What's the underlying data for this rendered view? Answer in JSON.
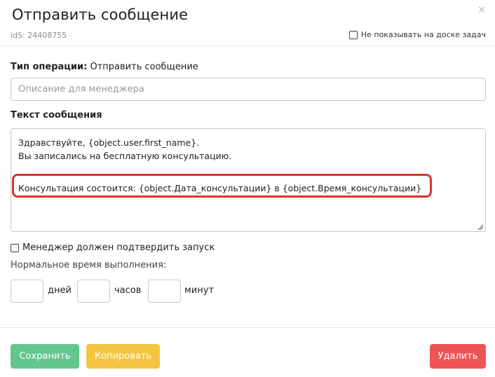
{
  "dialog": {
    "title": "Отправить сообщение",
    "close_glyph": "×",
    "ids_text": "idS: 24408755",
    "hide_on_board_label": "Не показывать на доске задач"
  },
  "operation": {
    "type_label": "Тип операции:",
    "type_value": "Отправить сообщение",
    "description_placeholder": "Описание для менеджера"
  },
  "message": {
    "label": "Текст сообщения",
    "lines": [
      "Здравствуйте,  {object.user.first_name}.",
      "Вы записались на бесплатную консультацию.",
      "",
      "Консультация состоится: {object.Дата_консультации} в {object.Время_консультации}"
    ],
    "highlight_color": "#d9352d"
  },
  "confirm": {
    "label": "Менеджер должен подтвердить запуск",
    "checked": false
  },
  "execution_time": {
    "label": "Нормальное время выполнения:",
    "days_label": "дней",
    "hours_label": "часов",
    "minutes_label": "минут",
    "days_value": "",
    "hours_value": "",
    "minutes_value": ""
  },
  "buttons": {
    "save_label": "Сохранить",
    "copy_label": "Копировать",
    "delete_label": "Удалить",
    "save_color": "#63c68d",
    "copy_color": "#f4c542",
    "delete_color": "#ee5454"
  }
}
